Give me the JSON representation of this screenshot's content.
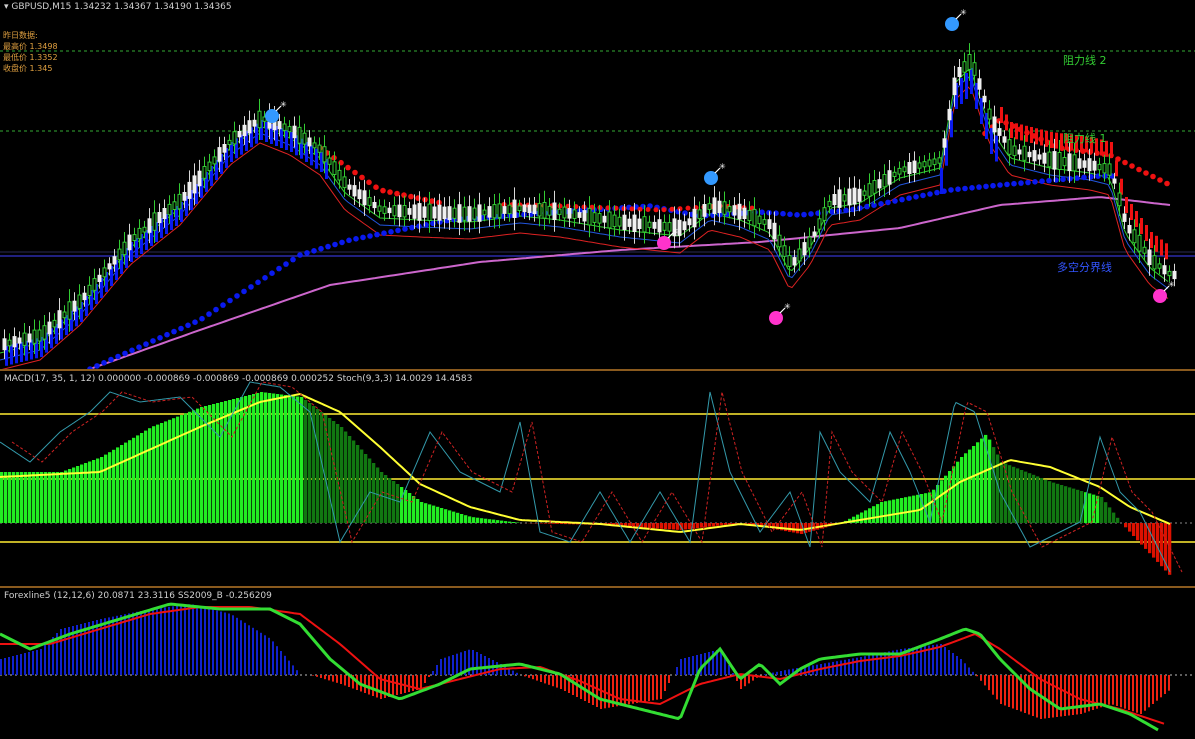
{
  "main": {
    "symbol": "GBPUSD,M15",
    "ohlc": "1.34232 1.34367 1.34190 1.34365",
    "info_title": "昨日数据:",
    "info_high": "最高价 1.3498",
    "info_low": "最低价 1.3352",
    "info_close": "收盘价 1.345",
    "resistance2": "阻力线 2",
    "resistance1": "阻力线 1",
    "divider": "多空分界线",
    "colors": {
      "bull_candle": "#f0f0f0",
      "bear_candle": "#33cc33",
      "ma_blue": "#0000ff",
      "ma_red": "#ff0000",
      "ma_violet": "#cc66cc",
      "level_line": "#33aa33",
      "divider_line": "#3333cc"
    }
  },
  "macd": {
    "title": "MACD(17, 35, 1, 12) 0.000000 -0.000869 -0.000869 -0.000869 0.000252",
    "stoch": "Stoch(9,3,3) 14.0029 14.4583",
    "colors": {
      "bar_bright": "#22ee22",
      "bar_dark": "#117711",
      "bar_red": "#dd1100",
      "signal": "#ffff33",
      "stoch_main": "#3399aa",
      "stoch_signal": "#cc2222"
    }
  },
  "fx": {
    "title": "Forexline5 (12,12,6) 20.0871 23.3116",
    "extra": "SS2009_B -0.256209",
    "colors": {
      "pos": "#1122cc",
      "neg": "#ee2211",
      "fast": "#33dd33",
      "slow": "#ee1111"
    }
  },
  "icons": [
    "bomb-icon"
  ]
}
